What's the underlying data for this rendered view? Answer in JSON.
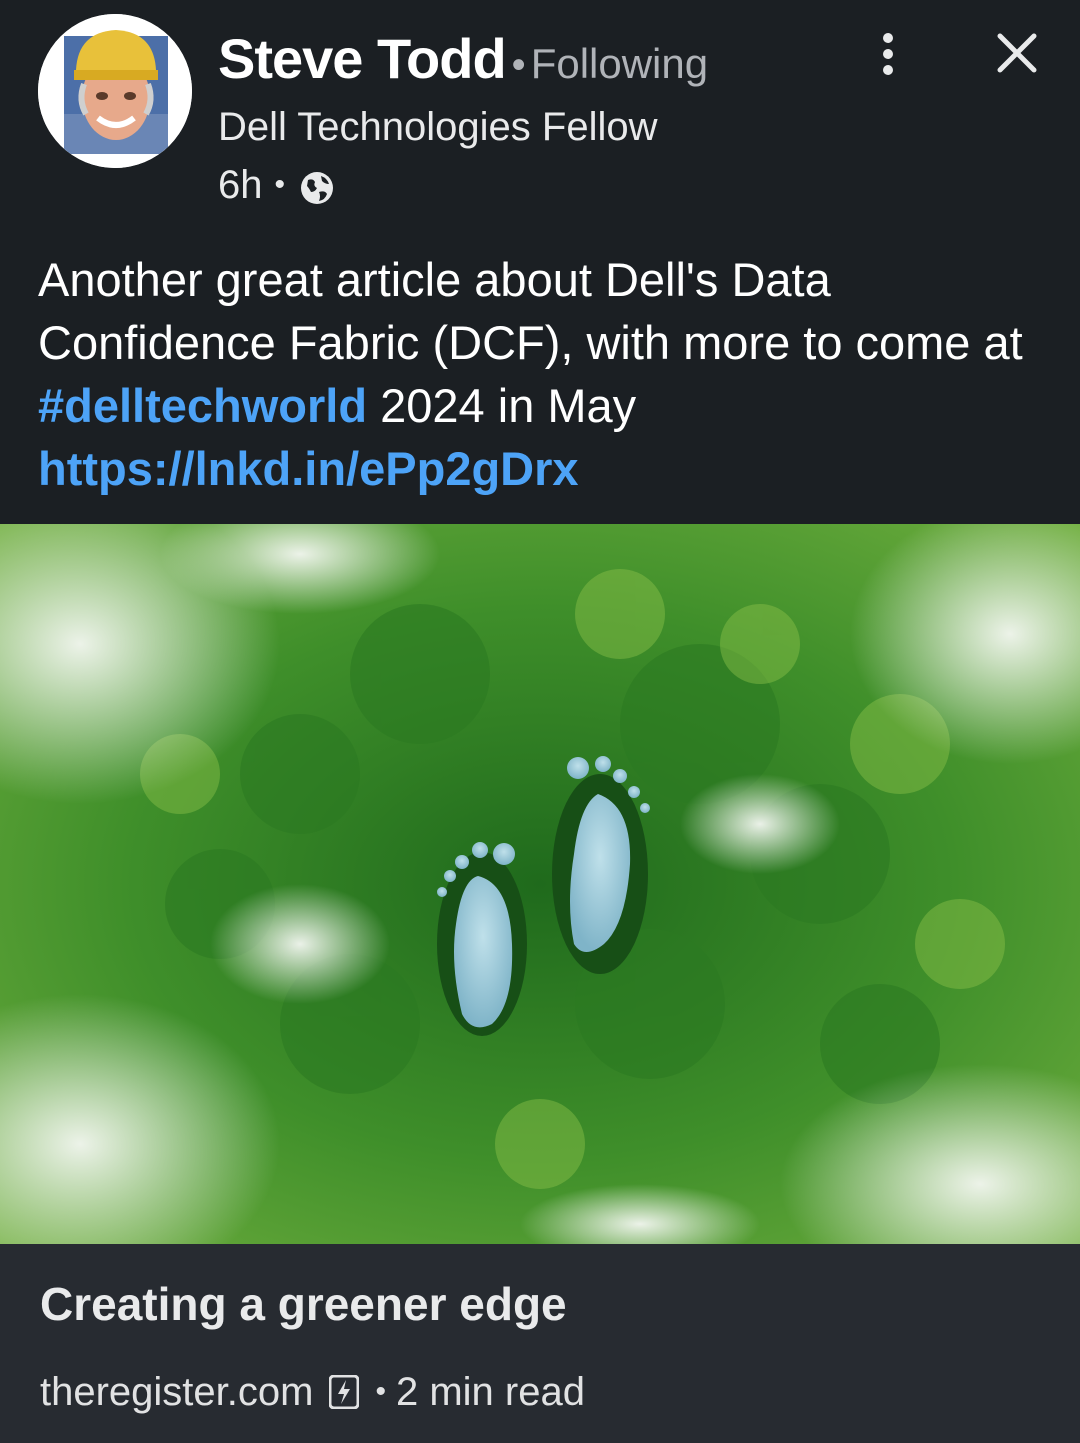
{
  "author": {
    "name": "Steve Todd",
    "follow_status": "Following",
    "headline": "Dell Technologies Fellow",
    "time_ago": "6h",
    "visibility_icon": "globe-icon"
  },
  "header_actions": {
    "more_icon": "more-vertical-icon",
    "close_icon": "close-icon"
  },
  "post": {
    "text_part1": "Another great article about Dell's Data Confidence Fabric (DCF), with more to come at ",
    "hashtag": "#delltechworld",
    "text_part2": " 2024 in May",
    "link": "https://lnkd.in/ePp2gDrx"
  },
  "article_card": {
    "image_description_icon": "forest-footprints-image",
    "title": "Creating a greener edge",
    "source": "theregister.com",
    "source_icon": "amp-lightning-icon",
    "read_time": "2 min read"
  },
  "colors": {
    "background": "#1b1f23",
    "card_footer": "#272b31",
    "link": "#4da3f7",
    "secondary_text": "#b0b3b8"
  }
}
